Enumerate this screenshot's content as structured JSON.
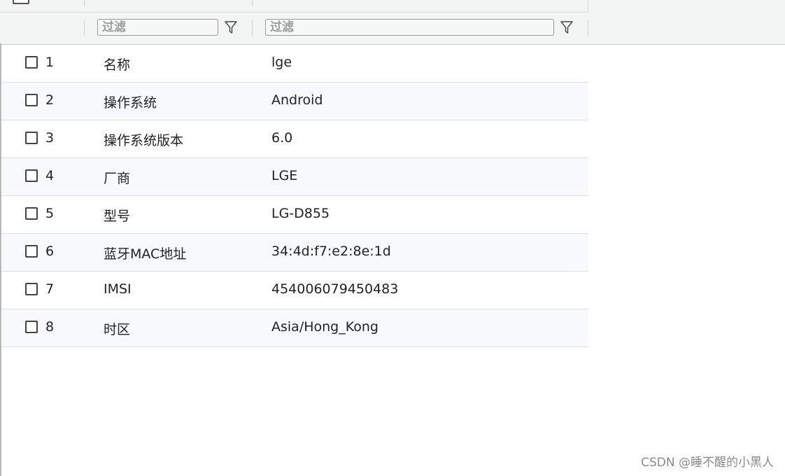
{
  "filter": {
    "name_placeholder": "过滤",
    "value_placeholder": "过滤"
  },
  "icons": {
    "filter": "filter-funnel-icon",
    "checkbox": "checkbox-icon"
  },
  "rows": [
    {
      "index": "1",
      "name": "名称",
      "value": "lge"
    },
    {
      "index": "2",
      "name": "操作系统",
      "value": "Android"
    },
    {
      "index": "3",
      "name": "操作系统版本",
      "value": "6.0"
    },
    {
      "index": "4",
      "name": "厂商",
      "value": "LGE"
    },
    {
      "index": "5",
      "name": "型号",
      "value": "LG-D855"
    },
    {
      "index": "6",
      "name": "蓝牙MAC地址",
      "value": "34:4d:f7:e2:8e:1d"
    },
    {
      "index": "7",
      "name": "IMSI",
      "value": "454006079450483"
    },
    {
      "index": "8",
      "name": "时区",
      "value": "Asia/Hong_Kong"
    }
  ],
  "watermark": "CSDN @睡不醒的小黑人",
  "colors": {
    "header_bg": "#f3f4f4",
    "alt_row_bg": "#f8f9fc",
    "border": "#dcdde0"
  }
}
